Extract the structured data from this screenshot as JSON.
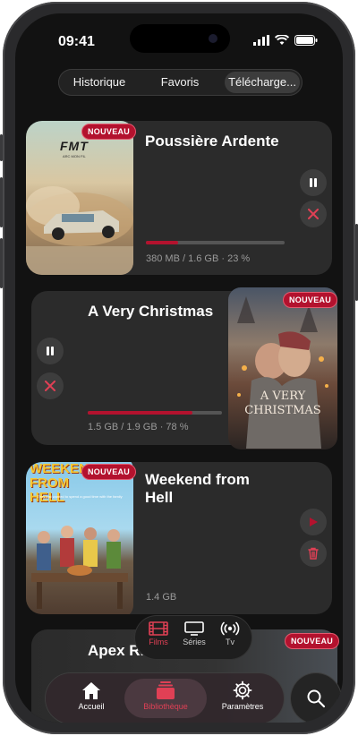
{
  "status_bar": {
    "time": "09:41"
  },
  "segments": [
    {
      "label": "Historique"
    },
    {
      "label": "Favoris"
    },
    {
      "label": "Télécharge..."
    }
  ],
  "downloads": [
    {
      "title": "Poussière Ardente",
      "badge": "NOUVEAU",
      "meta": "380 MB / 1.6 GB · 23 %",
      "progress": 0.23,
      "poster_text": "FMT",
      "poster_sub": "ARC MON FIL",
      "actions": [
        "pause-icon",
        "cancel-icon"
      ]
    },
    {
      "title": "A Very Christmas",
      "badge": "NOUVEAU",
      "meta": "1.5 GB / 1.9 GB · 78 %",
      "progress": 0.78,
      "poster_text": "A VERY CHRISTMAS",
      "actions": [
        "pause-icon",
        "cancel-icon"
      ]
    },
    {
      "title": "Weekend from Hell",
      "badge": "NOUVEAU",
      "meta": "1.4 GB",
      "poster_text": "WEEKEND FROM HELL",
      "poster_sub": "They just wanted to spend a good time with the family",
      "actions": [
        "play-icon",
        "trash-icon"
      ]
    },
    {
      "title": "Apex Rivals",
      "badge": "NOUVEAU"
    }
  ],
  "mini_tabs": [
    {
      "label": "Films",
      "icon": "film-icon",
      "active": true
    },
    {
      "label": "Séries",
      "icon": "tv-icon"
    },
    {
      "label": "Tv",
      "icon": "broadcast-icon"
    }
  ],
  "tab_bar": [
    {
      "label": "Accueil",
      "icon": "home-icon"
    },
    {
      "label": "Bibliothèque",
      "icon": "library-icon",
      "active": true
    },
    {
      "label": "Paramètres",
      "icon": "gear-icon"
    }
  ],
  "colors": {
    "accent": "#b3122e",
    "background": "#121212",
    "card": "#2b2b2b"
  }
}
